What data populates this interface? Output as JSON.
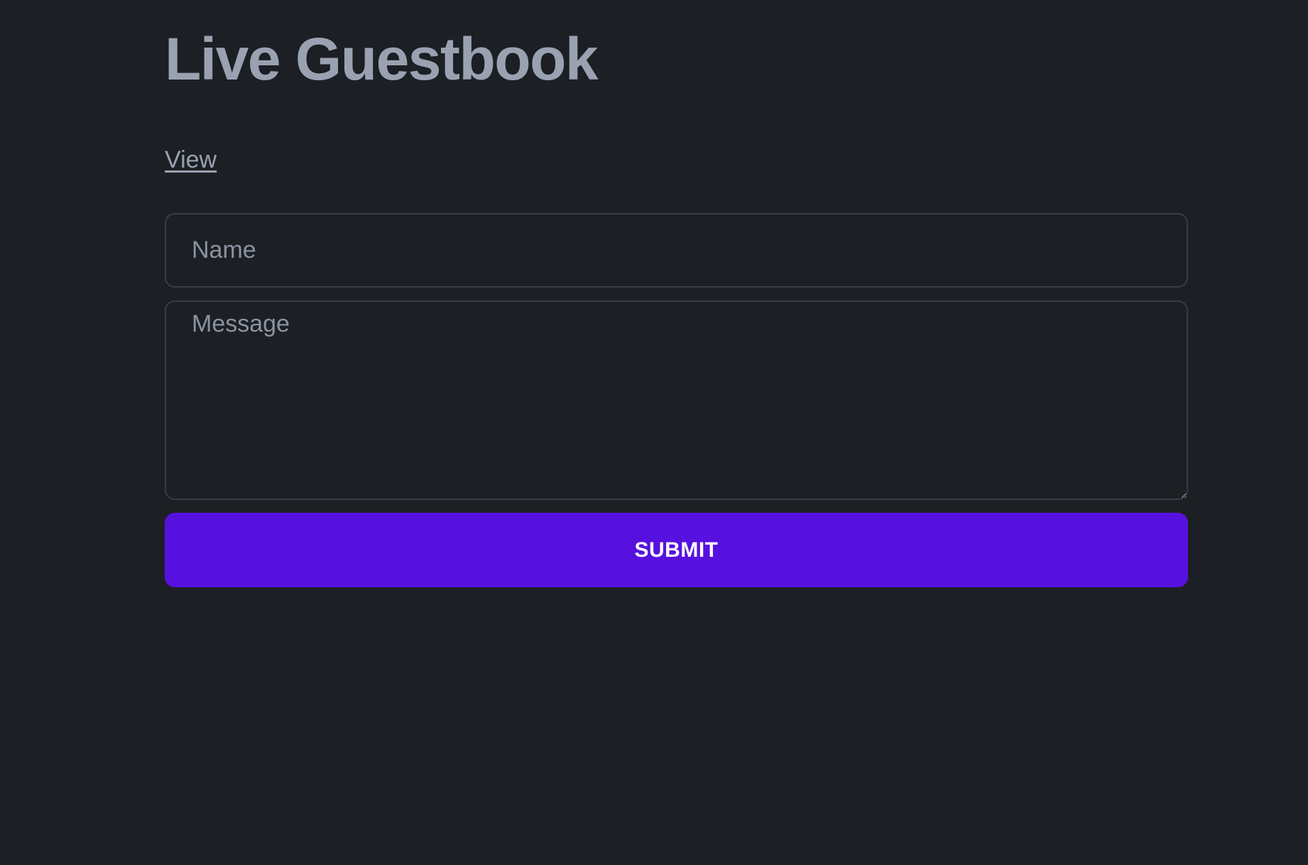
{
  "page": {
    "title": "Live Guestbook",
    "view_link_label": "View"
  },
  "form": {
    "name_placeholder": "Name",
    "name_value": "",
    "message_placeholder": "Message",
    "message_value": "",
    "submit_label": "SUBMIT"
  },
  "colors": {
    "background": "#1c1f24",
    "title_text": "#9aa2b1",
    "field_border": "#383c43",
    "placeholder_text": "#8b93a1",
    "submit_background": "#5711df",
    "submit_text": "#ffffff"
  }
}
